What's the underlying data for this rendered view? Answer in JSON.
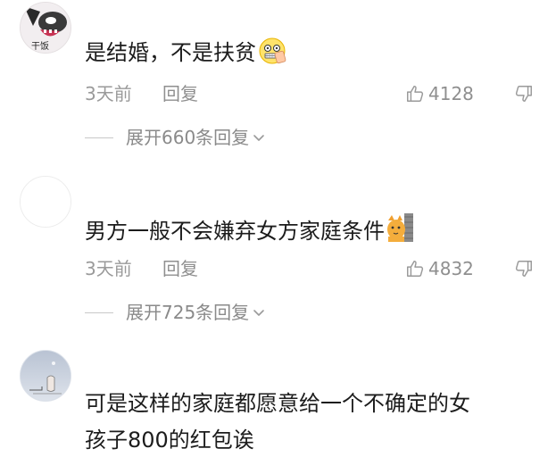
{
  "comments": [
    {
      "avatar_icon": "anime-avatar-icon",
      "avatar_badge": "干饭",
      "text": "是结婚，不是扶贫",
      "emoji": "zipper-mouth-emoji-icon",
      "time": "3天前",
      "reply_label": "回复",
      "like_count": "4128",
      "expand_label": "展开660条回复"
    },
    {
      "avatar_icon": "blank-avatar-icon",
      "text": "男方一般不会嫌弃女方家庭条件",
      "emoji": "cat-peeking-emoji-icon",
      "time": "3天前",
      "reply_label": "回复",
      "like_count": "4832",
      "expand_label": "展开725条回复"
    },
    {
      "avatar_icon": "drawing-avatar-icon",
      "text_line1": "可是这样的家庭都愿意给一个不确定的女",
      "text_line2": "孩子800的红包诶"
    }
  ],
  "colors": {
    "text_primary": "#1c1c1c",
    "text_secondary": "#9a9a9a",
    "background": "#ffffff"
  }
}
